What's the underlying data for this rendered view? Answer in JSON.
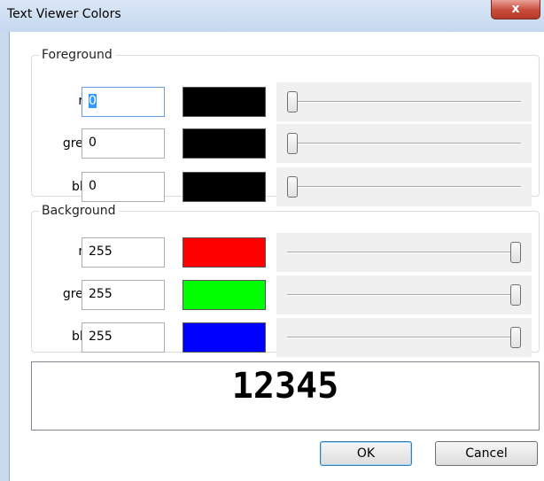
{
  "window": {
    "title": "Text Viewer Colors",
    "close_glyph": "x"
  },
  "foreground": {
    "legend": "Foreground",
    "rows": [
      {
        "label": "red:",
        "value": "0",
        "color": "#000000",
        "level": 0
      },
      {
        "label": "green:",
        "value": "0",
        "color": "#000000",
        "level": 0
      },
      {
        "label": "blue:",
        "value": "0",
        "color": "#000000",
        "level": 0
      }
    ]
  },
  "background": {
    "legend": "Background",
    "rows": [
      {
        "label": "red:",
        "value": "255",
        "color": "#ff0000",
        "level": 1
      },
      {
        "label": "green:",
        "value": "255",
        "color": "#00ff00",
        "level": 1
      },
      {
        "label": "blue:",
        "value": "255",
        "color": "#0000ff",
        "level": 1
      }
    ]
  },
  "preview": {
    "text": "12345"
  },
  "buttons": {
    "ok": "OK",
    "cancel": "Cancel"
  }
}
